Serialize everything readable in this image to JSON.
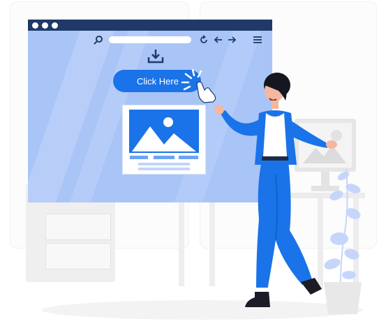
{
  "illustration": {
    "cta_label": "Click Here",
    "icons": [
      "search-icon",
      "refresh-icon",
      "back-arrow-icon",
      "forward-arrow-icon",
      "menu-icon",
      "download-icon",
      "image-placeholder-icon",
      "cursor-hand-icon",
      "monitor-icon",
      "plant-icon"
    ],
    "colors": {
      "accent": "#1a73e8",
      "browser_window": "#a9c4f7",
      "browser_bar": "#1f3a68",
      "figure_pants": "#1a73e8",
      "furniture": "#efefef"
    }
  }
}
